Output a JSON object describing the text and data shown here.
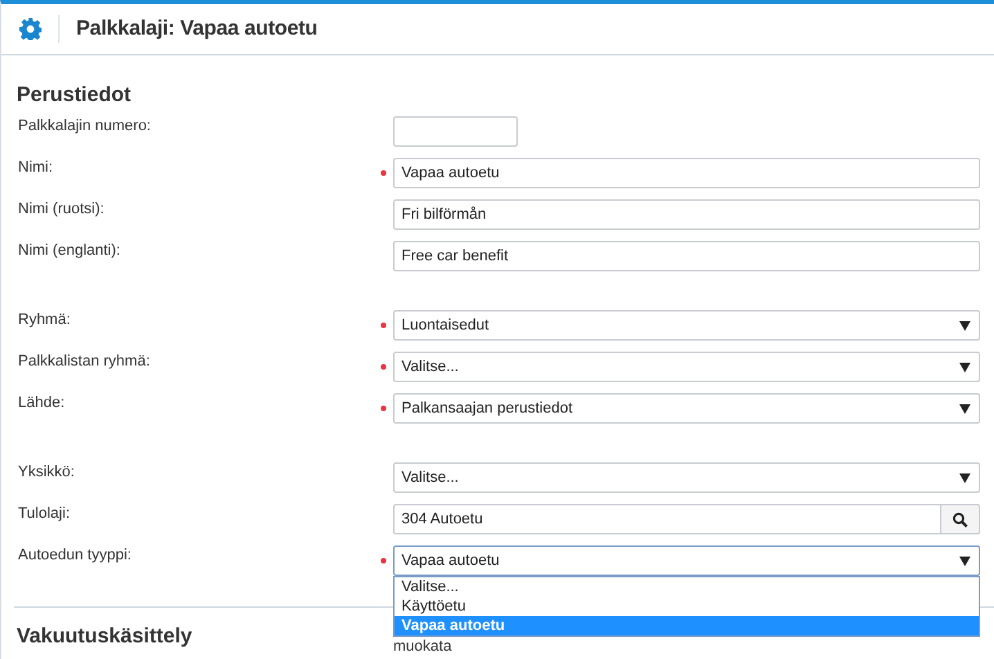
{
  "header": {
    "title": "Palkkalaji: Vapaa autoetu"
  },
  "sections": [
    {
      "title": "Perustiedot",
      "groups": [
        [
          {
            "label": "Palkkalajin numero:",
            "kind": "number",
            "required": false
          },
          {
            "label": "Nimi:",
            "kind": "text",
            "required": true,
            "value": "Vapaa autoetu"
          },
          {
            "label": "Nimi (ruotsi):",
            "kind": "text",
            "required": false,
            "value": "Fri bilförmån"
          },
          {
            "label": "Nimi (englanti):",
            "kind": "text",
            "required": false,
            "value": "Free car benefit"
          }
        ],
        [
          {
            "label": "Ryhmä:",
            "kind": "select",
            "required": true,
            "value": "Luontaisedut"
          },
          {
            "label": "Palkkalistan ryhmä:",
            "kind": "select",
            "required": true,
            "value": "Valitse..."
          },
          {
            "label": "Lähde:",
            "kind": "select",
            "required": true,
            "value": "Palkansaajan perustiedot"
          }
        ],
        [
          {
            "label": "Yksikkö:",
            "kind": "select",
            "required": false,
            "value": "Valitse..."
          },
          {
            "label": "Tulolaji:",
            "kind": "lookup",
            "required": false,
            "value": "304 Autoetu"
          },
          {
            "label": "Autoedun tyyppi:",
            "kind": "select",
            "required": true,
            "value": "Vapaa autoetu",
            "expanded": true,
            "options": [
              {
                "label": "Valitse...",
                "selected": false
              },
              {
                "label": "Käyttöetu",
                "selected": false
              },
              {
                "label": "Vapaa autoetu",
                "selected": true
              }
            ]
          }
        ]
      ]
    },
    {
      "title": "Vakuutuskäsittely",
      "text": "muokata"
    }
  ]
}
